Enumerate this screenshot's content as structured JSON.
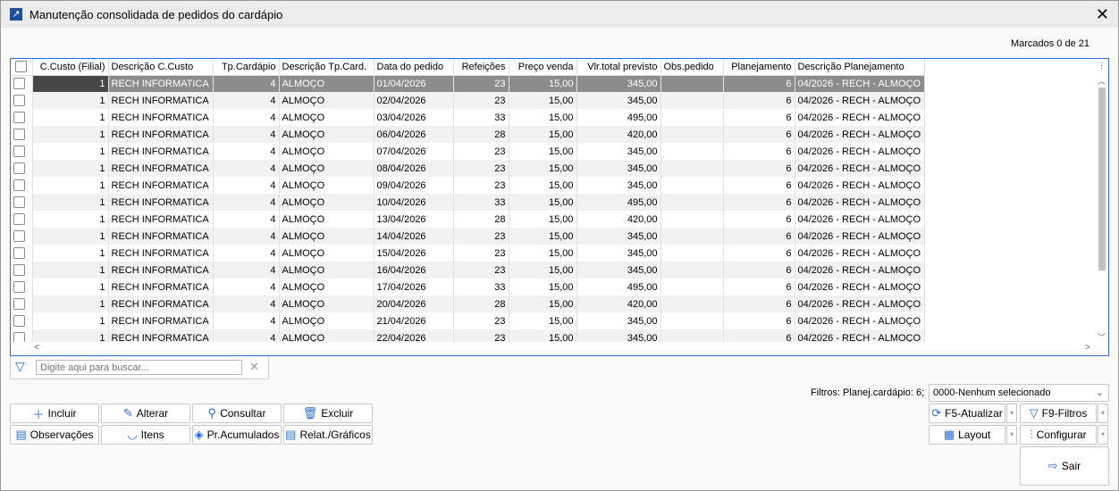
{
  "window": {
    "title": "Manutenção consolidada de pedidos do cardápio"
  },
  "marcados": "Marcados 0 de 21",
  "columns": [
    "C.Custo (Filial)",
    "Descrição C.Custo",
    "Tp.Cardápio",
    "Descrição Tp.Card.",
    "Data do pedido",
    "Refeições",
    "Preço venda",
    "Vlr.total previsto",
    "Obs.pedido",
    "Planejamento",
    "Descrição Planejamento"
  ],
  "rows": [
    [
      "1",
      "RECH INFORMATICA",
      "4",
      "ALMOÇO",
      "01/04/2026",
      "23",
      "15,00",
      "345,00",
      "",
      "6",
      "04/2026 - RECH - ALMOÇO"
    ],
    [
      "1",
      "RECH INFORMATICA",
      "4",
      "ALMOÇO",
      "02/04/2026",
      "23",
      "15,00",
      "345,00",
      "",
      "6",
      "04/2026 - RECH - ALMOÇO"
    ],
    [
      "1",
      "RECH INFORMATICA",
      "4",
      "ALMOÇO",
      "03/04/2026",
      "33",
      "15,00",
      "495,00",
      "",
      "6",
      "04/2026 - RECH - ALMOÇO"
    ],
    [
      "1",
      "RECH INFORMATICA",
      "4",
      "ALMOÇO",
      "06/04/2026",
      "28",
      "15,00",
      "420,00",
      "",
      "6",
      "04/2026 - RECH - ALMOÇO"
    ],
    [
      "1",
      "RECH INFORMATICA",
      "4",
      "ALMOÇO",
      "07/04/2026",
      "23",
      "15,00",
      "345,00",
      "",
      "6",
      "04/2026 - RECH - ALMOÇO"
    ],
    [
      "1",
      "RECH INFORMATICA",
      "4",
      "ALMOÇO",
      "08/04/2026",
      "23",
      "15,00",
      "345,00",
      "",
      "6",
      "04/2026 - RECH - ALMOÇO"
    ],
    [
      "1",
      "RECH INFORMATICA",
      "4",
      "ALMOÇO",
      "09/04/2026",
      "23",
      "15,00",
      "345,00",
      "",
      "6",
      "04/2026 - RECH - ALMOÇO"
    ],
    [
      "1",
      "RECH INFORMATICA",
      "4",
      "ALMOÇO",
      "10/04/2026",
      "33",
      "15,00",
      "495,00",
      "",
      "6",
      "04/2026 - RECH - ALMOÇO"
    ],
    [
      "1",
      "RECH INFORMATICA",
      "4",
      "ALMOÇO",
      "13/04/2026",
      "28",
      "15,00",
      "420,00",
      "",
      "6",
      "04/2026 - RECH - ALMOÇO"
    ],
    [
      "1",
      "RECH INFORMATICA",
      "4",
      "ALMOÇO",
      "14/04/2026",
      "23",
      "15,00",
      "345,00",
      "",
      "6",
      "04/2026 - RECH - ALMOÇO"
    ],
    [
      "1",
      "RECH INFORMATICA",
      "4",
      "ALMOÇO",
      "15/04/2026",
      "23",
      "15,00",
      "345,00",
      "",
      "6",
      "04/2026 - RECH - ALMOÇO"
    ],
    [
      "1",
      "RECH INFORMATICA",
      "4",
      "ALMOÇO",
      "16/04/2026",
      "23",
      "15,00",
      "345,00",
      "",
      "6",
      "04/2026 - RECH - ALMOÇO"
    ],
    [
      "1",
      "RECH INFORMATICA",
      "4",
      "ALMOÇO",
      "17/04/2026",
      "33",
      "15,00",
      "495,00",
      "",
      "6",
      "04/2026 - RECH - ALMOÇO"
    ],
    [
      "1",
      "RECH INFORMATICA",
      "4",
      "ALMOÇO",
      "20/04/2026",
      "28",
      "15,00",
      "420,00",
      "",
      "6",
      "04/2026 - RECH - ALMOÇO"
    ],
    [
      "1",
      "RECH INFORMATICA",
      "4",
      "ALMOÇO",
      "21/04/2026",
      "23",
      "15,00",
      "345,00",
      "",
      "6",
      "04/2026 - RECH - ALMOÇO"
    ],
    [
      "1",
      "RECH INFORMATICA",
      "4",
      "ALMOÇO",
      "22/04/2026",
      "23",
      "15,00",
      "345,00",
      "",
      "6",
      "04/2026 - RECH - ALMOÇO"
    ]
  ],
  "search": {
    "placeholder": "Digite aqui para buscar..."
  },
  "buttons": {
    "incluir": "Incluir",
    "alterar": "Alterar",
    "consultar": "Consultar",
    "excluir": "Excluir",
    "observacoes": "Observações",
    "itens": "Itens",
    "acumulados": "Pr.Acumulados",
    "relat": "Relat./Gráficos",
    "atualizar": "F5-Atualizar",
    "filtros": "F9-Filtros",
    "layout": "Layout",
    "configurar": "Configurar",
    "sair": "Sair"
  },
  "filter": {
    "label": "Filtros: Planej.cardápio: 6;",
    "value": "0000-Nenhum selecionado"
  }
}
